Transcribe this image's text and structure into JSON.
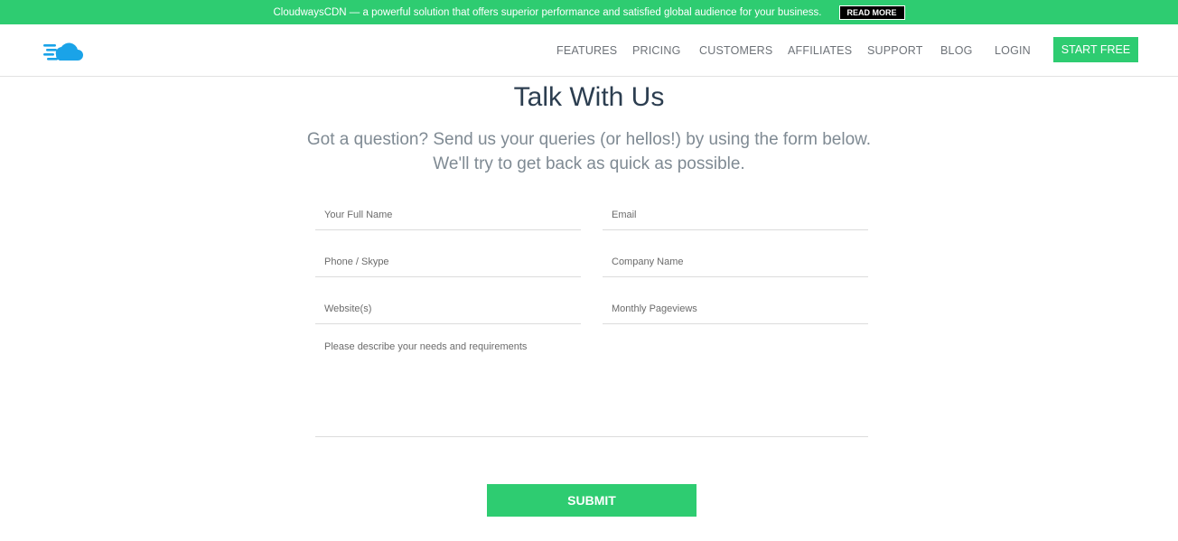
{
  "promo": {
    "text": "CloudwaysCDN — a powerful solution that offers superior performance and satisfied global audience for your business.",
    "button_label": "READ MORE"
  },
  "header": {
    "logo_icon": "cloud-speed-icon",
    "nav": [
      {
        "label": "FEATURES"
      },
      {
        "label": "PRICING"
      },
      {
        "label": "CUSTOMERS"
      },
      {
        "label": "AFFILIATES"
      },
      {
        "label": "SUPPORT"
      },
      {
        "label": "BLOG"
      },
      {
        "label": "LOGIN"
      }
    ],
    "cta_label": "START FREE"
  },
  "main": {
    "title": "Talk With Us",
    "subtitle_line1": "Got a question? Send us your queries (or hellos!) by using the form below.",
    "subtitle_line2": "We'll try to get back as quick as possible."
  },
  "form": {
    "full_name_placeholder": "Your Full Name",
    "email_placeholder": "Email",
    "phone_placeholder": "Phone / Skype",
    "company_placeholder": "Company Name",
    "website_placeholder": "Website(s)",
    "pageviews_placeholder": "Monthly Pageviews",
    "needs_placeholder": "Please describe your needs and requirements",
    "submit_label": "SUBMIT"
  },
  "colors": {
    "accent": "#2ecc71",
    "logo_blue": "#1aa3e8",
    "title": "#2c3e50",
    "nav_text": "#6d7278"
  }
}
